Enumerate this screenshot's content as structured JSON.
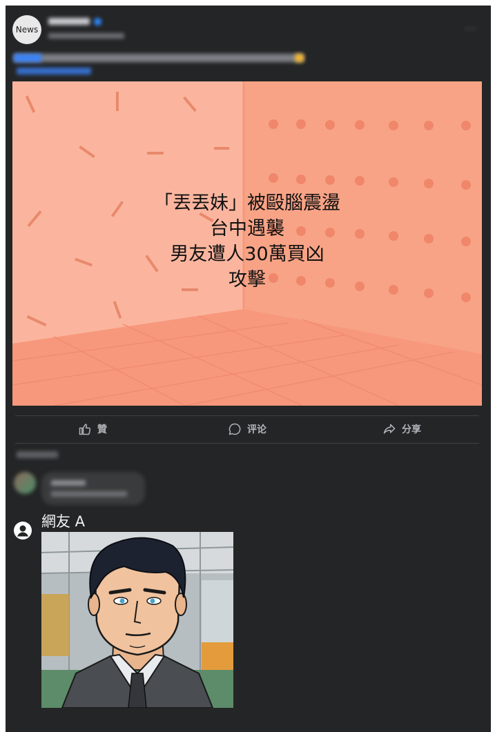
{
  "post": {
    "avatar_text": "News",
    "more_icon": "more-horizontal-icon",
    "image": {
      "headline_lines": [
        "「丟丟妹」被毆腦震盪",
        "台中遇襲",
        "男友遭人30萬買凶",
        "攻擊"
      ],
      "background_color": "#f9a98d"
    },
    "actions": [
      {
        "label": "贊",
        "icon": "thumbs-up-icon"
      },
      {
        "label": "评论",
        "icon": "comment-icon"
      },
      {
        "label": "分享",
        "icon": "share-icon"
      }
    ]
  },
  "reply": {
    "avatar_icon": "user-circle-icon",
    "name": "網友 A"
  },
  "colors": {
    "card_bg": "#242526",
    "action_text": "#b0b3b8",
    "hero_bg": "#f9a98d"
  }
}
